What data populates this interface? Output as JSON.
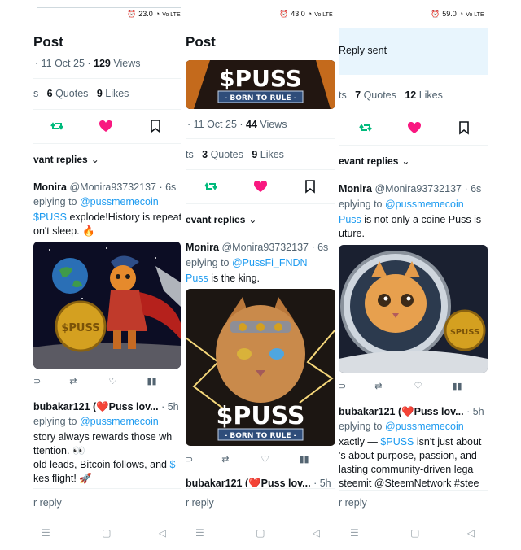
{
  "status": {
    "time_left": "23.0",
    "time_mid": "43.0",
    "time_right": "59.0",
    "signal_label": "Vo LTE",
    "network_speed_unit": "KB/S"
  },
  "panel1": {
    "title": "Post",
    "date_views": "· 11 Oct 25 · ",
    "views_count": "129",
    "views_label": " Views",
    "quotes_count": "6",
    "quotes_label": " Quotes",
    "likes_count": "9",
    "likes_label": " Likes",
    "stats_prefix": "s",
    "replies_sort": "vant replies",
    "reply1": {
      "name": "Monira",
      "handle": "@Monira93732137 · 6s",
      "replying": "eplying to ",
      "replying_link": "@pussmemecoin",
      "text_link": "$PUSS",
      "text": " explode!History is repeat",
      "text2": "on't sleep. 🔥"
    },
    "reply2": {
      "name": "bubakar121 (❤️Puss lov...",
      "time": " · 5h",
      "replying": "eplying to ",
      "replying_link": "@pussmemecoin",
      "line1": " story always rewards those wh",
      "line2": "ttention. 👀",
      "line3": "old leads, Bitcoin follows, and ",
      "line3_link": "$",
      "line4": "kes flight! 🚀"
    },
    "image_coin_text": "$PUSS",
    "composer": "r reply"
  },
  "panel2": {
    "title": "Post",
    "banner_big": "$PUSS",
    "banner_small": "- BORN TO RULE -",
    "date_views": "· 11 Oct 25 · ",
    "views_count": "44",
    "views_label": " Views",
    "stats_prefix": "ts",
    "quotes_count": "3",
    "quotes_label": " Quotes",
    "likes_count": "9",
    "likes_label": " Likes",
    "replies_sort": "evant replies",
    "reply1": {
      "name": "Monira",
      "handle": "@Monira93732137 · 6s",
      "replying": "eplying to ",
      "replying_link": "@PussFi_FNDN",
      "text_link": "Puss",
      "text": " is the king."
    },
    "image_big": "$PUSS",
    "image_small": "- BORN TO RULE -",
    "reply2": {
      "name": "bubakar121 (❤️Puss lov...",
      "time": " · 5h"
    },
    "composer": "r reply"
  },
  "panel3": {
    "toast": "Reply sent",
    "stats_prefix": "ts",
    "quotes_count": "7",
    "quotes_label": " Quotes",
    "likes_count": "12",
    "likes_label": " Likes",
    "replies_sort": "evant replies",
    "reply1": {
      "name": "Monira",
      "handle": "@Monira93732137 · 6s",
      "replying": "eplying to ",
      "replying_link": "@pussmemecoin",
      "text_link": "Puss",
      "text": " is not only a coine Puss is",
      "text2": "uture."
    },
    "image_coin_text": "$PUSS",
    "reply2": {
      "name": "bubakar121 (❤️Puss lov...",
      "time": " · 5h",
      "replying": "eplying to ",
      "replying_link": "@pussmemecoin",
      "line1a": "xactly — ",
      "line1_link": "$PUSS",
      "line1b": " isn't just about",
      "line2": "'s about purpose, passion, and",
      "line3": " lasting community-driven lega",
      "line4_link": "steemit @SteemNetwork #stee"
    },
    "composer": "r reply"
  },
  "colors": {
    "accent": "#1d9bf0",
    "like": "#f91880",
    "repost": "#00ba7c"
  }
}
